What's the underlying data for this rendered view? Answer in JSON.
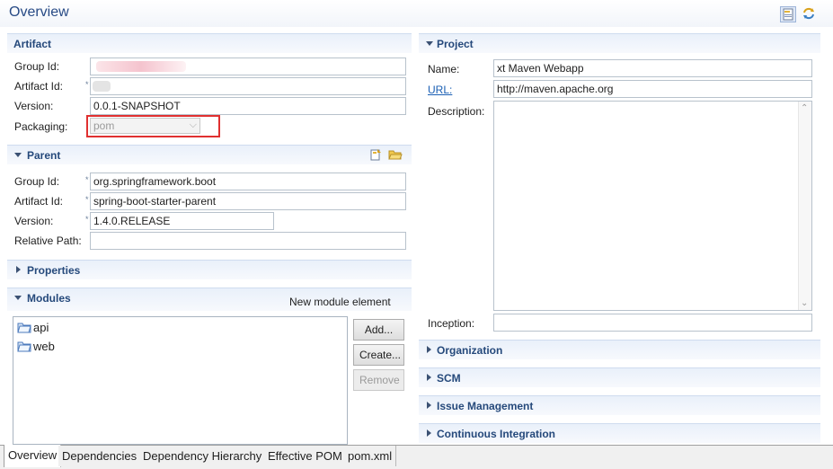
{
  "header": {
    "title": "Overview",
    "icons": [
      "pom-overview-icon",
      "refresh-icon"
    ]
  },
  "artifact": {
    "title": "Artifact",
    "group_id_label": "Group Id:",
    "group_id_value": "",
    "artifact_id_label": "Artifact Id:",
    "artifact_id_value": "",
    "version_label": "Version:",
    "version_value": "0.0.1-SNAPSHOT",
    "packaging_label": "Packaging:",
    "packaging_value": "pom",
    "highlight_color": "#e03030"
  },
  "parent": {
    "title": "Parent",
    "group_id_label": "Group Id:",
    "group_id_value": "org.springframework.boot",
    "artifact_id_label": "Artifact Id:",
    "artifact_id_value": "spring-boot-starter-parent",
    "version_label": "Version:",
    "version_value": "1.4.0.RELEASE",
    "relative_path_label": "Relative Path:",
    "relative_path_value": ""
  },
  "properties": {
    "title": "Properties"
  },
  "modules": {
    "title": "Modules",
    "hint": "New module element",
    "items": [
      "api",
      "web"
    ],
    "buttons": {
      "add": "Add...",
      "create": "Create...",
      "remove": "Remove"
    }
  },
  "project": {
    "title": "Project",
    "name_label": "Name:",
    "name_value": "xt Maven Webapp",
    "url_label": "URL:",
    "url_value": "http://maven.apache.org",
    "description_label": "Description:",
    "description_value": "",
    "inception_label": "Inception:",
    "inception_value": ""
  },
  "collapsed_sections": [
    "Organization",
    "SCM",
    "Issue Management",
    "Continuous Integration"
  ],
  "tabs": [
    "Overview",
    "Dependencies",
    "Dependency Hierarchy",
    "Effective POM",
    "pom.xml"
  ],
  "active_tab": "Overview",
  "colors": {
    "section_title": "#25497b",
    "header_title": "#274a85",
    "link": "#1a5fb4"
  }
}
